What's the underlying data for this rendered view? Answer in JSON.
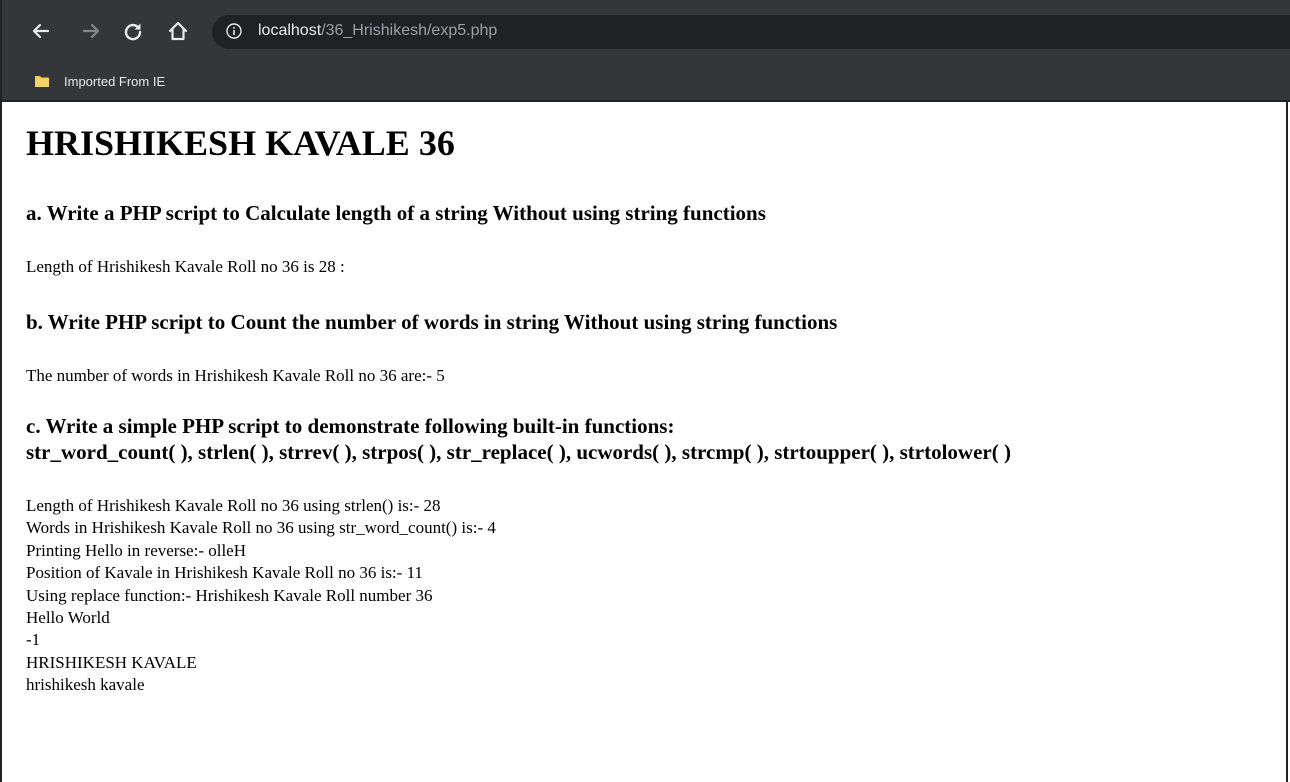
{
  "browser": {
    "url_host": "localhost",
    "url_path": "/36_Hrishikesh/exp5.php",
    "bookmark_label": "Imported From IE",
    "icons": {
      "back": "back-arrow-icon",
      "forward": "forward-arrow-icon",
      "reload": "reload-icon",
      "home": "home-icon",
      "info": "info-icon",
      "bookmark_folder": "folder-icon"
    },
    "colors": {
      "toolbar_bg": "#35363a",
      "omnibox_bg": "#202124",
      "folder_yellow": "#f2c84b"
    }
  },
  "page": {
    "title": "HRISHIKESH KAVALE 36",
    "section_a": {
      "heading": "a. Write a PHP script to Calculate length of a string Without using string functions",
      "output": "Length of Hrishikesh Kavale Roll no 36 is 28 :"
    },
    "section_b": {
      "heading": "b. Write PHP script to Count the number of words in string Without using string functions",
      "output": "The number of words in Hrishikesh Kavale Roll no 36 are:- 5"
    },
    "section_c": {
      "heading_line1": "c. Write a simple PHP script to demonstrate following built-in functions:",
      "heading_line2": "str_word_count( ), strlen( ), strrev( ), strpos( ), str_replace( ), ucwords( ), strcmp( ), strtoupper( ), strtolower( )",
      "outputs": [
        "Length of Hrishikesh Kavale Roll no 36 using strlen() is:- 28",
        "Words in Hrishikesh Kavale Roll no 36 using str_word_count() is:- 4",
        "Printing Hello in reverse:- olleH",
        "Position of Kavale in Hrishikesh Kavale Roll no 36 is:- 11",
        "Using replace function:- Hrishikesh Kavale Roll number 36",
        "Hello World",
        "-1",
        "HRISHIKESH KAVALE",
        "hrishikesh kavale"
      ]
    }
  }
}
